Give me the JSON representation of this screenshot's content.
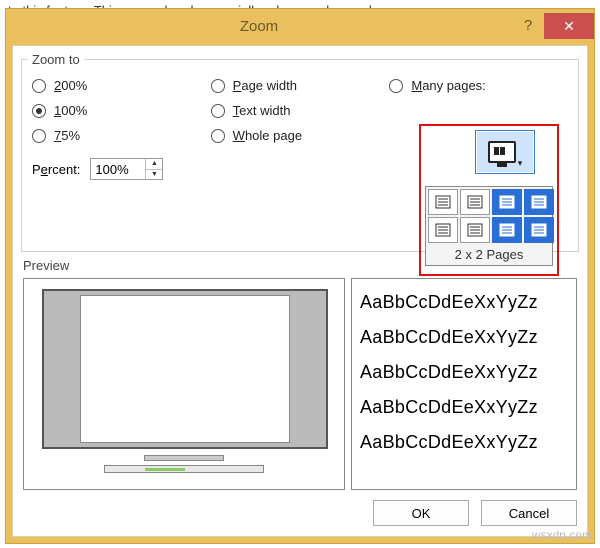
{
  "bg_text": "to this feature. This proves handy especially, when you have a huge,",
  "dialog": {
    "title": "Zoom",
    "help": "?",
    "close": "✕"
  },
  "zoom_to": {
    "legend": "Zoom to",
    "r200": "200%",
    "r100": "100%",
    "r75": "75%",
    "page_width": "Page width",
    "text_width": "Text width",
    "whole_page": "Whole page",
    "many_pages": "Many pages:",
    "percent_label": "Percent:",
    "percent_value": "100%",
    "selected": "100",
    "grid_label": "2 x 2 Pages"
  },
  "preview": {
    "label": "Preview",
    "sample": "AaBbCcDdEeXxYyZz"
  },
  "buttons": {
    "ok": "OK",
    "cancel": "Cancel"
  },
  "watermark": "wsxdn.com"
}
